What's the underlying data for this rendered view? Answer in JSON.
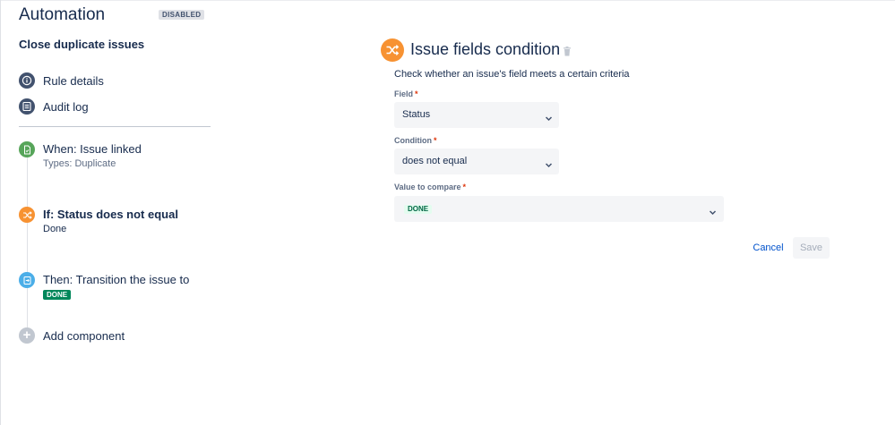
{
  "header": {
    "title": "Automation",
    "state_badge": "DISABLED"
  },
  "rule": {
    "name": "Close duplicate issues"
  },
  "nav": {
    "items": [
      {
        "label": "Rule details",
        "icon": "info-icon"
      },
      {
        "label": "Audit log",
        "icon": "list-icon"
      }
    ]
  },
  "steps": {
    "trigger": {
      "title": "When: Issue linked",
      "subtitle": "Types: Duplicate",
      "icon": "document-icon",
      "color": "#57a55a"
    },
    "condition": {
      "title": "If: Status does not equal",
      "subtitle": "Done",
      "icon": "shuffle-icon",
      "color": "#f79232"
    },
    "action": {
      "title": "Then: Transition the issue to",
      "badge": "DONE",
      "icon": "transition-icon",
      "color": "#4baee8"
    },
    "add": {
      "label": "Add component",
      "icon": "plus-icon"
    }
  },
  "panel": {
    "title": "Issue fields condition",
    "description": "Check whether an issue's field meets a certain criteria",
    "fields": {
      "field": {
        "label": "Field",
        "required": "*",
        "value": "Status"
      },
      "condition": {
        "label": "Condition",
        "required": "*",
        "value": "does not equal"
      },
      "compare": {
        "label": "Value to compare",
        "required": "*",
        "value": "DONE"
      }
    },
    "actions": {
      "cancel": "Cancel",
      "save": "Save"
    }
  },
  "colors": {
    "accent": "#0052cc",
    "condition_orange": "#f79232",
    "trigger_green": "#57a55a",
    "action_blue": "#4baee8",
    "done_green": "#00875a"
  }
}
